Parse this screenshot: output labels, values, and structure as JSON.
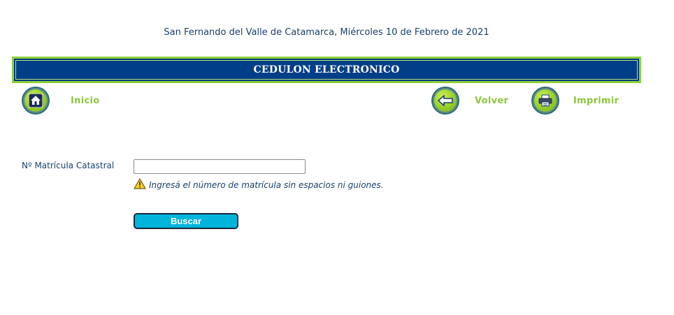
{
  "header": {
    "date_text": "San Fernando del Valle de Catamarca, Miércoles 10 de Febrero de 2021"
  },
  "banner": {
    "title": "CEDULON ELECTRONICO"
  },
  "nav": {
    "home": {
      "label": "Inicio",
      "icon": "home-icon"
    },
    "back": {
      "label": "Volver",
      "icon": "back-arrow-icon"
    },
    "print": {
      "label": "Imprimir",
      "icon": "printer-icon"
    }
  },
  "form": {
    "matricula_label": "Nº Matrícula Catastral",
    "matricula_value": "",
    "matricula_placeholder": "",
    "hint_text": "Ingresá el número de matrícula sin espacios ni guiones.",
    "hint_icon": "warning-icon",
    "search_label": "Buscar"
  },
  "colors": {
    "banner_green": "#8fcf3c",
    "banner_blue": "#003f87",
    "nav_label_green": "#8cc63f",
    "text_navy": "#1a3f6b",
    "button_cyan": "#00b4dc"
  }
}
